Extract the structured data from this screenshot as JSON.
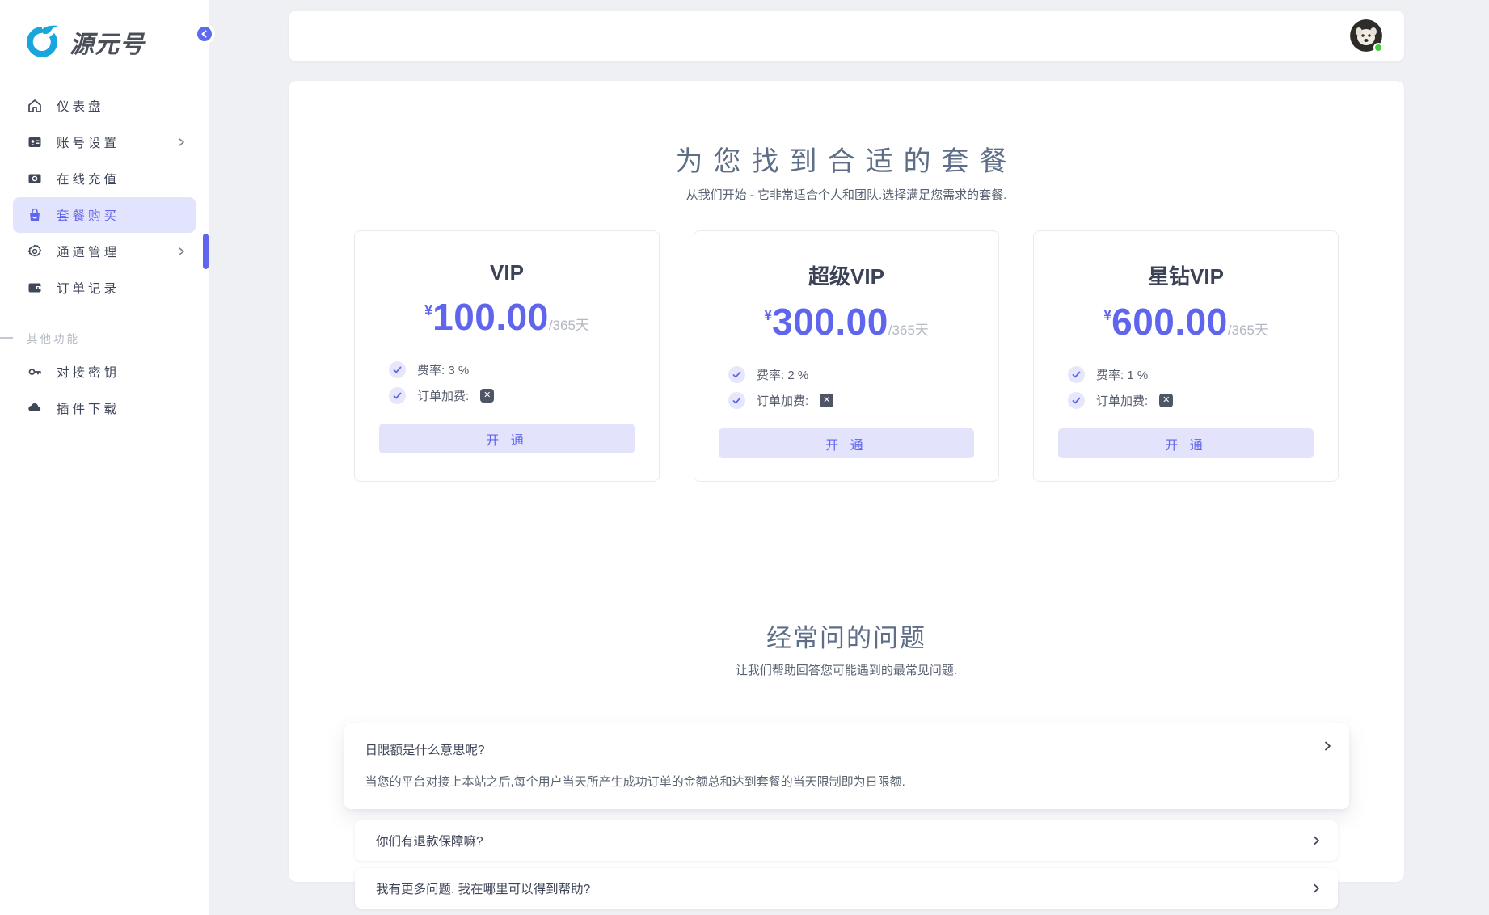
{
  "brand": {
    "logo_text": "源元号"
  },
  "sidebar": {
    "items": [
      {
        "label": "仪表盘"
      },
      {
        "label": "账号设置",
        "expandable": true
      },
      {
        "label": "在线充值"
      },
      {
        "label": "套餐购买",
        "active": true
      },
      {
        "label": "通道管理",
        "expandable": true
      },
      {
        "label": "订单记录"
      },
      {
        "label": "对接密钥"
      },
      {
        "label": "插件下载"
      }
    ],
    "section_label": "其他功能"
  },
  "pricing": {
    "title": "为您找到合适的套餐",
    "subtitle": "从我们开始 - 它非常适合个人和团队.选择满足您需求的套餐.",
    "currency": "¥",
    "period": "/365天",
    "rate_label": "费率:",
    "surcharge_label": "订单加费:",
    "surcharge_off_glyph": "✕",
    "open_button": "开 通",
    "plans": [
      {
        "name": "VIP",
        "price": "100.00",
        "rate": "3 %"
      },
      {
        "name": "超级VIP",
        "price": "300.00",
        "rate": "2 %"
      },
      {
        "name": "星钻VIP",
        "price": "600.00",
        "rate": "1 %"
      }
    ]
  },
  "faq": {
    "title": "经常问的问题",
    "subtitle": "让我们帮助回答您可能遇到的最常见问题.",
    "items": [
      {
        "question": "日限额是什么意思呢?",
        "answer": "当您的平台对接上本站之后,每个用户当天所产生成功订单的金额总和达到套餐的当天限制即为日限额.",
        "expanded": true
      },
      {
        "question": "你们有退款保障嘛?"
      },
      {
        "question": "我有更多问题. 我在哪里可以得到帮助?"
      }
    ]
  },
  "colors": {
    "accent": "#6065ee",
    "accent_soft": "#e3e4fc",
    "logo_blue": "#18a6dd",
    "status_green": "#43ce3b",
    "heading": "#5e6e87",
    "background": "#eef0f4"
  }
}
